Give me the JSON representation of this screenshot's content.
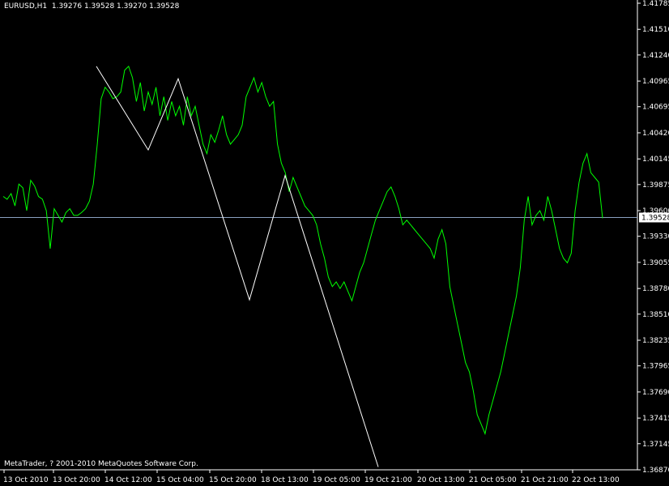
{
  "header": {
    "symbol": "EURUSD,H1",
    "open": "1.39276",
    "high": "1.39528",
    "low": "1.39270",
    "close": "1.39528"
  },
  "copyright": "MetaTrader, ? 2001-2010 MetaQuotes Software Corp.",
  "colors": {
    "background": "#000000",
    "price_line": "#00ff00",
    "zigzag": "#ffffff",
    "bid_line": "#8aa0c0",
    "axis": "#ffffff",
    "label_bg": "#ffffff",
    "label_text": "#000000"
  },
  "chart_data": {
    "type": "line",
    "series": [],
    "y_ticks": [
      "1.41785",
      "1.41510",
      "1.41240",
      "1.40965",
      "1.40695",
      "1.40420",
      "1.40145",
      "1.39875",
      "1.39600",
      "1.39330",
      "1.39055",
      "1.38780",
      "1.38510",
      "1.38235",
      "1.37965",
      "1.37690",
      "1.37415",
      "1.37145",
      "1.36870"
    ],
    "x_ticks": [
      "13 Oct 2010",
      "13 Oct 20:00",
      "14 Oct 12:00",
      "15 Oct 04:00",
      "15 Oct 20:00",
      "18 Oct 13:00",
      "19 Oct 05:00",
      "19 Oct 21:00",
      "20 Oct 13:00",
      "21 Oct 05:00",
      "21 Oct 21:00",
      "22 Oct 13:00"
    ],
    "ylim": [
      1.3687,
      1.41785
    ],
    "n_bars": 154,
    "close": [
      1.3975,
      1.3972,
      1.3978,
      1.3965,
      1.3988,
      1.3984,
      1.396,
      1.3992,
      1.3986,
      1.3975,
      1.3972,
      1.396,
      1.392,
      1.3962,
      1.3955,
      1.3948,
      1.3958,
      1.3962,
      1.3955,
      1.3955,
      1.3958,
      1.3962,
      1.397,
      1.3988,
      1.403,
      1.4078,
      1.409,
      1.4085,
      1.4078,
      1.408,
      1.4085,
      1.4108,
      1.4112,
      1.41,
      1.4075,
      1.4095,
      1.4065,
      1.4085,
      1.4072,
      1.409,
      1.406,
      1.408,
      1.4055,
      1.4075,
      1.406,
      1.407,
      1.405,
      1.408,
      1.406,
      1.407,
      1.405,
      1.403,
      1.402,
      1.404,
      1.4032,
      1.4045,
      1.406,
      1.404,
      1.403,
      1.4035,
      1.404,
      1.405,
      1.408,
      1.409,
      1.41,
      1.4085,
      1.4095,
      1.408,
      1.407,
      1.4075,
      1.403,
      1.401,
      1.4,
      1.398,
      1.3995,
      1.3985,
      1.3975,
      1.3965,
      1.396,
      1.3955,
      1.3945,
      1.3925,
      1.391,
      1.389,
      1.388,
      1.3885,
      1.3878,
      1.3885,
      1.3875,
      1.3865,
      1.388,
      1.3895,
      1.3905,
      1.392,
      1.3935,
      1.395,
      1.396,
      1.397,
      1.398,
      1.3985,
      1.3975,
      1.3962,
      1.3945,
      1.395,
      1.3945,
      1.394,
      1.3935,
      1.393,
      1.3925,
      1.392,
      1.391,
      1.393,
      1.394,
      1.3925,
      1.388,
      1.386,
      1.384,
      1.382,
      1.38,
      1.379,
      1.377,
      1.3745,
      1.3735,
      1.3725,
      1.3745,
      1.376,
      1.3775,
      1.379,
      1.381,
      1.383,
      1.385,
      1.387,
      1.39,
      1.395,
      1.3975,
      1.3945,
      1.3955,
      1.396,
      1.395,
      1.3975,
      1.396,
      1.394,
      1.392,
      1.391,
      1.3905,
      1.3915,
      1.396,
      1.399,
      1.401,
      1.402,
      1.4,
      1.3995,
      1.399,
      1.3952
    ],
    "zigzag": [
      [
        0,
        1.4112
      ],
      [
        1,
        1.4024
      ],
      [
        2,
        1.4099
      ],
      [
        3,
        1.3866
      ],
      [
        4,
        1.3997
      ],
      [
        5,
        1.369
      ]
    ],
    "bid": 1.39528
  }
}
